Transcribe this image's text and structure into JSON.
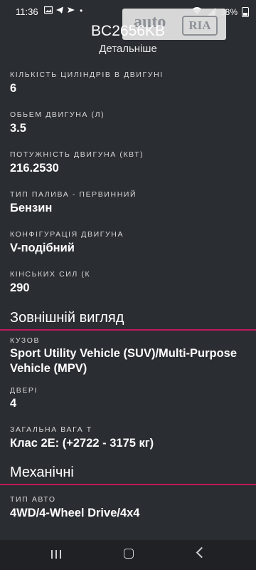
{
  "status_bar": {
    "time": "11:36",
    "battery": "38%"
  },
  "logo": {
    "text_auto": "auto",
    "text_ria": "RIA"
  },
  "header": {
    "title": "BC2656KB",
    "subtitle": "Детальніше"
  },
  "fields_engine": [
    {
      "label": "КІЛЬКІСТЬ ЦИЛІНДРІВ В ДВИГУНІ",
      "value": "6"
    },
    {
      "label": "ОБЬЕМ ДВИГУНА (Л)",
      "value": "3.5"
    },
    {
      "label": "ПОТУЖНІСТЬ ДВИГУНА (КВТ)",
      "value": "216.2530"
    },
    {
      "label": "ТИП ПАЛИВА - ПЕРВИННИЙ",
      "value": "Бензин"
    },
    {
      "label": "КОНФІГУРАЦІЯ ДВИГУНА",
      "value": "V-подібний"
    },
    {
      "label": "КІНСЬКИХ СИЛ (К",
      "value": "290"
    }
  ],
  "section_exterior": {
    "title": "Зовнішній вигляд",
    "fields": [
      {
        "label": "КУЗОВ",
        "value": "Sport Utility Vehicle (SUV)/Multi-Purpose Vehicle (MPV)"
      },
      {
        "label": "ДВЕРІ",
        "value": "4"
      },
      {
        "label": "ЗАГАЛЬНА ВАГА Т",
        "value": "Клас 2E: (+2722 - 3175 кг)"
      }
    ]
  },
  "section_mechanical": {
    "title": "Механічні",
    "fields": [
      {
        "label": "ТИП АВТО",
        "value": "4WD/4-Wheel Drive/4x4"
      }
    ]
  },
  "colors": {
    "background": "#2a2d32",
    "accent_line": "#c2185b",
    "navbar": "#1f2125"
  },
  "icons": [
    "image-icon",
    "telegram-icon",
    "send-icon",
    "wifi-icon",
    "signal-icon",
    "battery-icon",
    "recents-icon",
    "home-icon",
    "back-icon"
  ]
}
